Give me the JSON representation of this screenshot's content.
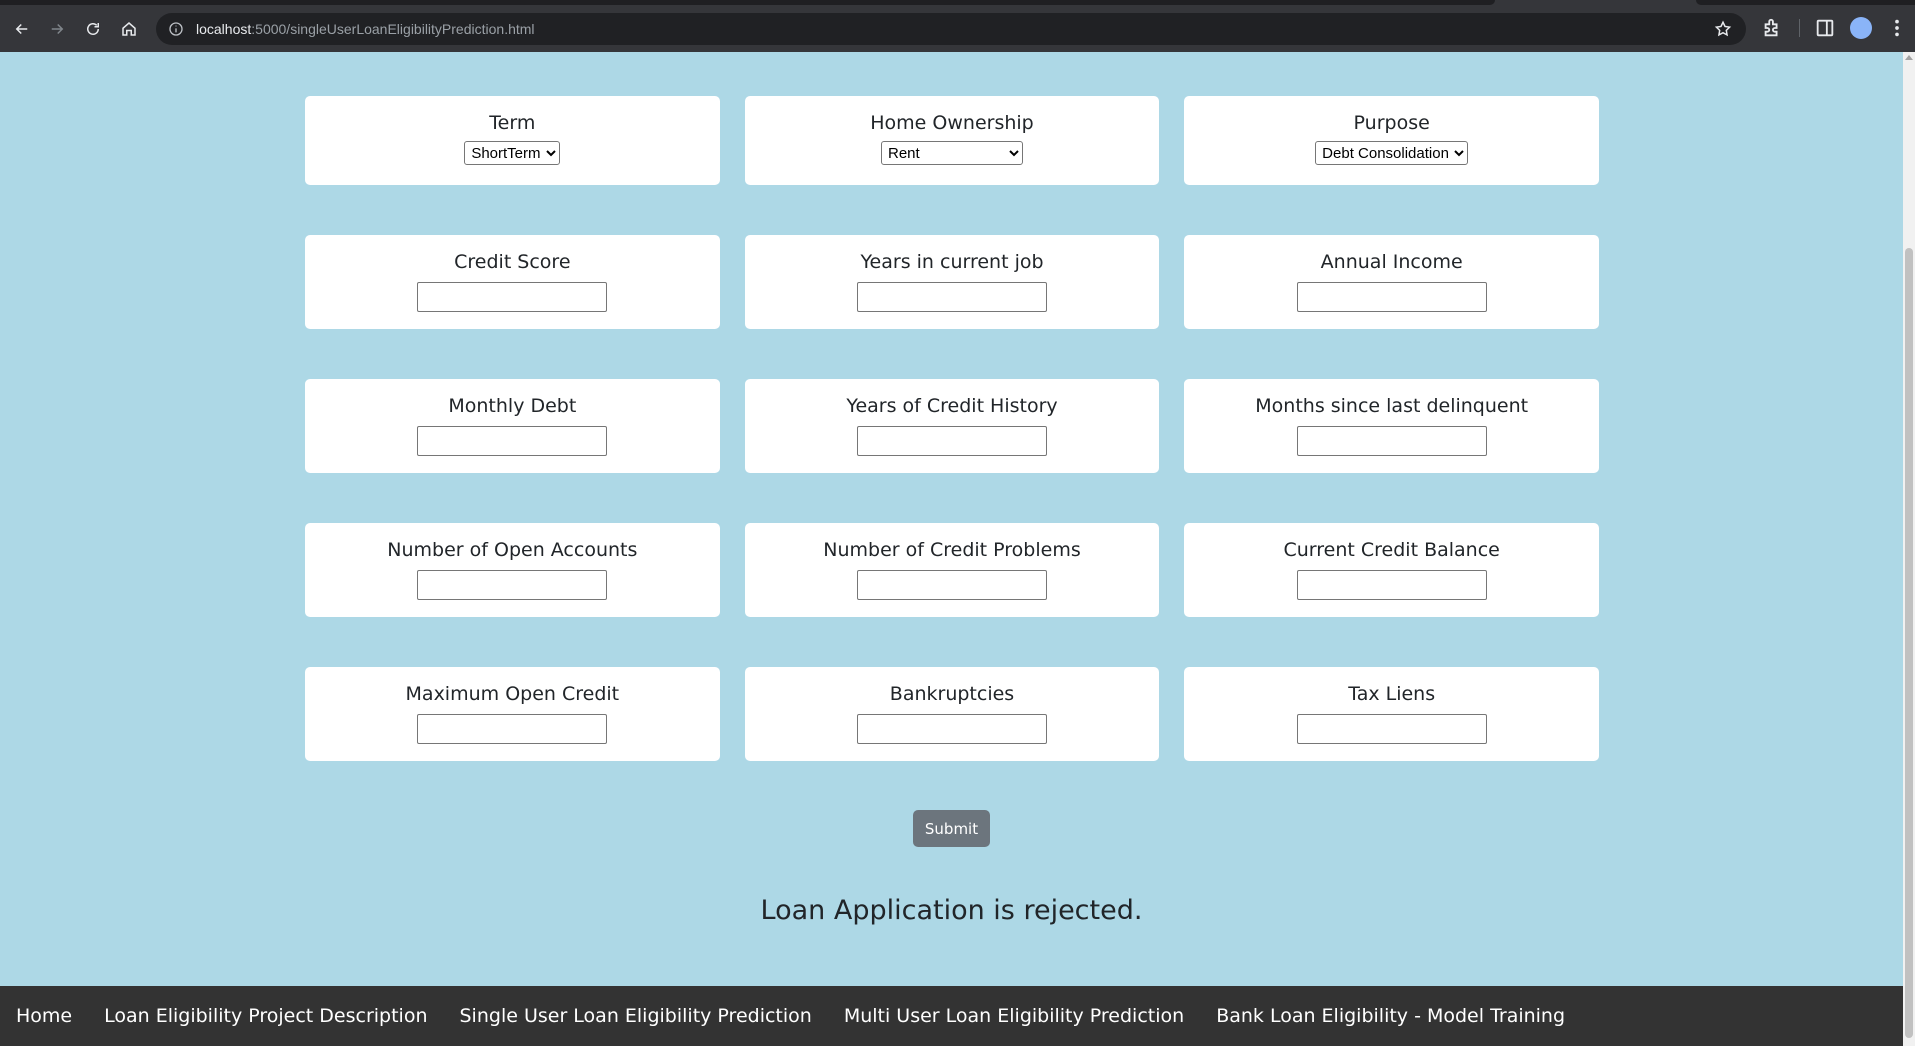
{
  "browser": {
    "url_host": "localhost",
    "url_rest": ":5000/singleUserLoanEligibilityPrediction.html"
  },
  "form": {
    "rows": [
      [
        {
          "label": "Term",
          "type": "select",
          "value": "ShortTerm"
        },
        {
          "label": "Home Ownership",
          "type": "select",
          "value": "Rent"
        },
        {
          "label": "Purpose",
          "type": "select",
          "value": "Debt Consolidation"
        }
      ],
      [
        {
          "label": "Credit Score",
          "type": "input",
          "value": ""
        },
        {
          "label": "Years in current job",
          "type": "input",
          "value": ""
        },
        {
          "label": "Annual Income",
          "type": "input",
          "value": ""
        }
      ],
      [
        {
          "label": "Monthly Debt",
          "type": "input",
          "value": ""
        },
        {
          "label": "Years of Credit History",
          "type": "input",
          "value": ""
        },
        {
          "label": "Months since last delinquent",
          "type": "input",
          "value": ""
        }
      ],
      [
        {
          "label": "Number of Open Accounts",
          "type": "input",
          "value": ""
        },
        {
          "label": "Number of Credit Problems",
          "type": "input",
          "value": ""
        },
        {
          "label": "Current Credit Balance",
          "type": "input",
          "value": ""
        }
      ],
      [
        {
          "label": "Maximum Open Credit",
          "type": "input",
          "value": ""
        },
        {
          "label": "Bankruptcies",
          "type": "input",
          "value": ""
        },
        {
          "label": "Tax Liens",
          "type": "input",
          "value": ""
        }
      ]
    ],
    "submit_label": "Submit"
  },
  "result_text": "Loan Application is rejected.",
  "footer": {
    "links": [
      "Home",
      "Loan Eligibility Project Description",
      "Single User Loan Eligibility Prediction",
      "Multi User Loan Eligibility Prediction",
      "Bank Loan Eligibility - Model Training"
    ]
  },
  "colors": {
    "page_background": "#add8e6",
    "footer_background": "#333333",
    "submit_background": "#6c757d"
  }
}
